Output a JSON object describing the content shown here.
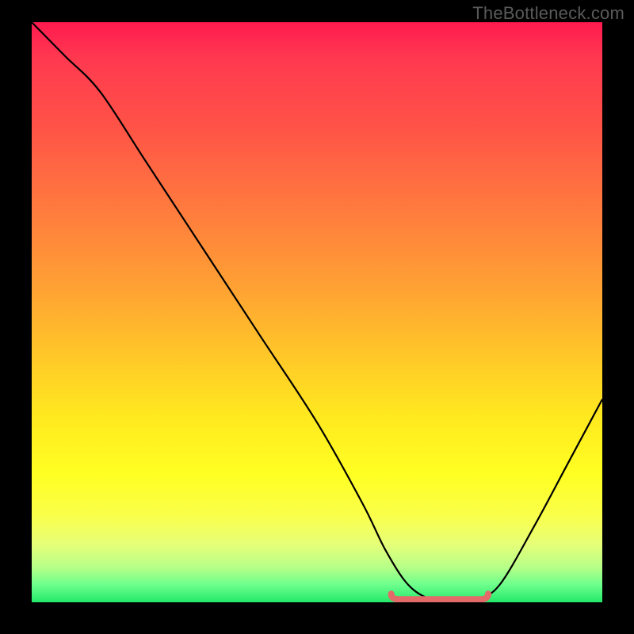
{
  "watermark": "TheBottleneck.com",
  "colors": {
    "background": "#000000",
    "curve": "#000000",
    "marker": "#e46a6a",
    "watermark": "#5a5a5a"
  },
  "chart_data": {
    "type": "line",
    "title": "",
    "xlabel": "",
    "ylabel": "",
    "xlim": [
      0,
      100
    ],
    "ylim": [
      0,
      100
    ],
    "note": "x = normalized horizontal position (0–100 left→right); y = bottleneck percentage (0 at bottom, 100 at top). Curve estimated from pixels; no axis ticks shown.",
    "series": [
      {
        "name": "bottleneck-curve",
        "x": [
          0,
          3,
          6,
          12,
          20,
          30,
          40,
          50,
          58,
          62,
          66,
          70,
          74,
          78,
          82,
          88,
          94,
          100
        ],
        "y": [
          100,
          97,
          94,
          88,
          76,
          61,
          46,
          31,
          17,
          9,
          3,
          0.5,
          0.4,
          0.6,
          3,
          13,
          24,
          35
        ]
      }
    ],
    "optimal_range": {
      "x_start": 63,
      "x_end": 80,
      "y": 0.5
    },
    "gradient_stops": [
      {
        "pct": 0,
        "color": "#ff1a4f"
      },
      {
        "pct": 50,
        "color": "#ffbf2d"
      },
      {
        "pct": 80,
        "color": "#ffff22"
      },
      {
        "pct": 100,
        "color": "#23e86a"
      }
    ]
  }
}
